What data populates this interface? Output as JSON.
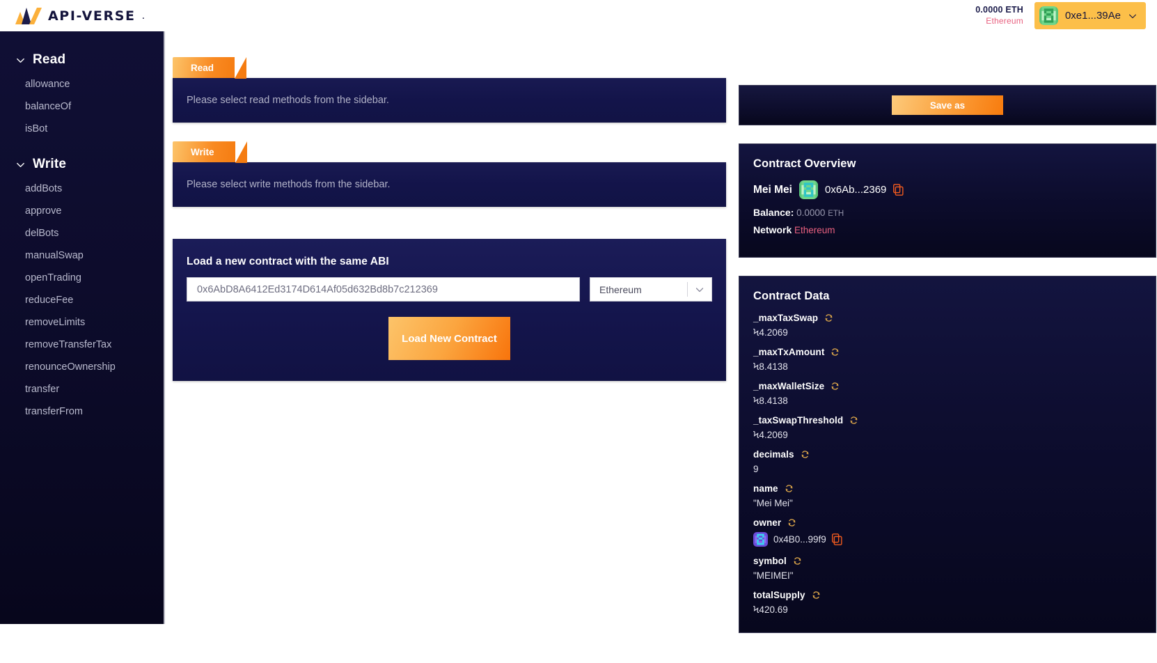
{
  "header": {
    "logo_text": "API-VERSE",
    "logo_dot": ".",
    "logo_mark_icon": "api-verse-logo-icon",
    "wallet": {
      "balance": "0.0000 ETH",
      "network": "Ethereum",
      "address": "0xe1...39Ae",
      "avatar_icon": "wallet-avatar-blockie-icon",
      "chevron_icon": "chevron-down-icon"
    }
  },
  "sidebar": {
    "groups": [
      {
        "title": "Read",
        "chevron_icon": "chevron-down-icon",
        "items": [
          "allowance",
          "balanceOf",
          "isBot"
        ]
      },
      {
        "title": "Write",
        "chevron_icon": "chevron-down-icon",
        "items": [
          "addBots",
          "approve",
          "delBots",
          "manualSwap",
          "openTrading",
          "reduceFee",
          "removeLimits",
          "removeTransferTax",
          "renounceOwnership",
          "transfer",
          "transferFrom"
        ]
      }
    ]
  },
  "main": {
    "read_panel": {
      "tab_label": "Read",
      "message": "Please select read methods from the sidebar."
    },
    "write_panel": {
      "tab_label": "Write",
      "message": "Please select write methods from the sidebar."
    },
    "load_contract": {
      "title": "Load a new contract with the same ABI",
      "address_value": "0x6AbD8A6412Ed3174D614Af05d632Bd8b7c212369",
      "address_placeholder": "0x6AbD8A6412Ed3174D614Af05d632Bd8b7c212369",
      "chain_selected": "Ethereum",
      "chain_chevron_icon": "chevron-down-icon",
      "button_label": "Load New Contract"
    }
  },
  "right": {
    "save_as_label": "Save as",
    "overview": {
      "title": "Contract Overview",
      "contract_name": "Mei Mei",
      "avatar_icon": "contract-avatar-blockie-icon",
      "address": "0x6Ab...2369",
      "copy_icon": "copy-icon",
      "balance_label": "Balance:",
      "balance_value": "0.0000",
      "balance_unit": "ETH",
      "network_label": "Network",
      "network_value": "Ethereum"
    },
    "contract_data": {
      "title": "Contract Data",
      "refresh_icon": "refresh-icon",
      "copy_icon": "copy-icon",
      "owner_avatar_icon": "owner-avatar-blockie-icon",
      "rows": [
        {
          "key": "_maxTaxSwap",
          "value": "Ϟ4.2069",
          "type": "text"
        },
        {
          "key": "_maxTxAmount",
          "value": "Ϟ8.4138",
          "type": "text"
        },
        {
          "key": "_maxWalletSize",
          "value": "Ϟ8.4138",
          "type": "text"
        },
        {
          "key": "_taxSwapThreshold",
          "value": "Ϟ4.2069",
          "type": "text"
        },
        {
          "key": "decimals",
          "value": "9",
          "type": "text"
        },
        {
          "key": "name",
          "value": "\"Mei Mei\"",
          "type": "text"
        },
        {
          "key": "owner",
          "value": "0x4B0...99f9",
          "type": "address"
        },
        {
          "key": "symbol",
          "value": "\"MEIMEI\"",
          "type": "text"
        },
        {
          "key": "totalSupply",
          "value": "Ϟ420.69",
          "type": "text"
        }
      ]
    }
  },
  "colors": {
    "accent_orange": "#f8740c",
    "accent_yellow": "#fcbf49",
    "navy_panel": "#13144a",
    "dark_navy": "#07071c",
    "pink": "#e8607f"
  }
}
